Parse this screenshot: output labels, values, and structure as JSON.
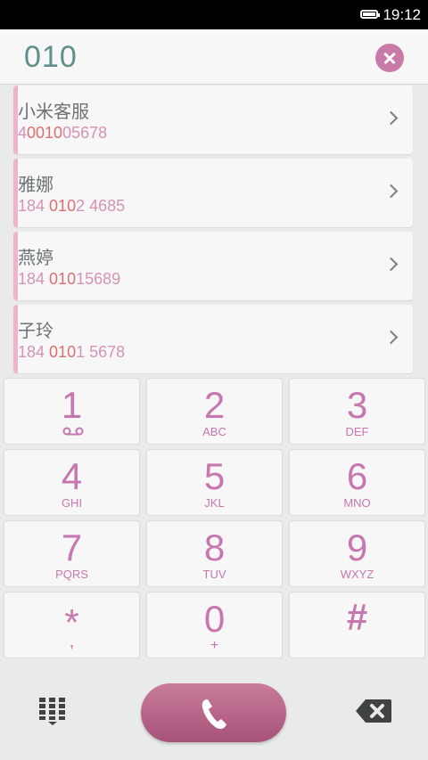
{
  "status_bar": {
    "time": "19:12"
  },
  "input": {
    "value": "010"
  },
  "contacts": [
    {
      "name": "小米客服",
      "phone_pre": "4",
      "phone_hl": "0010",
      "phone_post": "05678"
    },
    {
      "name": "雅娜",
      "phone_pre": "184 ",
      "phone_hl": "010",
      "phone_post": "2 4685"
    },
    {
      "name": "燕婷",
      "phone_pre": "184 ",
      "phone_hl": "010",
      "phone_post": "15689"
    },
    {
      "name": "子玲",
      "phone_pre": "184 ",
      "phone_hl": "010",
      "phone_post": "1 5678"
    }
  ],
  "keys": [
    {
      "digit": "1",
      "letters": ""
    },
    {
      "digit": "2",
      "letters": "ABC"
    },
    {
      "digit": "3",
      "letters": "DEF"
    },
    {
      "digit": "4",
      "letters": "GHI"
    },
    {
      "digit": "5",
      "letters": "JKL"
    },
    {
      "digit": "6",
      "letters": "MNO"
    },
    {
      "digit": "7",
      "letters": "PQRS"
    },
    {
      "digit": "8",
      "letters": "TUV"
    },
    {
      "digit": "9",
      "letters": "WXYZ"
    },
    {
      "digit": "*",
      "letters": ","
    },
    {
      "digit": "0",
      "letters": "+"
    },
    {
      "digit": "#",
      "letters": ""
    }
  ],
  "icons": {
    "battery": "battery-icon",
    "clear": "clear-icon",
    "chevron": "chevron-right-icon",
    "voicemail": "voicemail-icon",
    "dialpad": "dialpad-icon",
    "call": "phone-icon",
    "backspace": "backspace-icon"
  },
  "colors": {
    "accent": "#c777b0",
    "number_text": "#5e8f8a",
    "match_highlight": "#dc6f72",
    "call_button": "#b6648a"
  }
}
